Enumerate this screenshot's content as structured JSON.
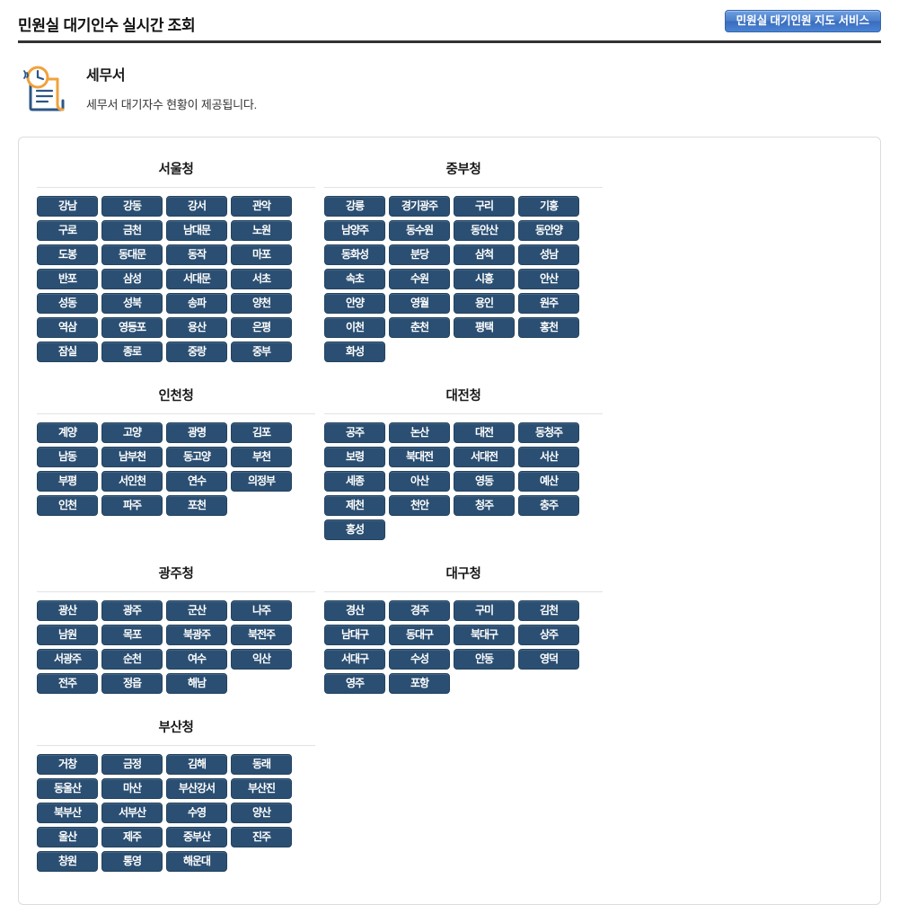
{
  "header": {
    "title": "민원실 대기인수 실시간 조회",
    "map_service_label": "민원실 대기인원 지도 서비스"
  },
  "intro": {
    "icon": "clock-document-icon",
    "heading": "세무서",
    "description": "세무서 대기자수 현황이 제공됩니다."
  },
  "colors": {
    "office_button_bg": "#2b4f72",
    "office_button_border": "#24435f",
    "map_button_bg": "#4a7fcc",
    "panel_border": "#dcdcdc",
    "header_rule": "#333333",
    "icon_navy": "#2d5686",
    "icon_orange": "#f0a23c"
  },
  "regions": [
    {
      "name": "서울청",
      "offices": [
        "강남",
        "강동",
        "강서",
        "관악",
        "구로",
        "금천",
        "남대문",
        "노원",
        "도봉",
        "동대문",
        "동작",
        "마포",
        "반포",
        "삼성",
        "서대문",
        "서초",
        "성동",
        "성북",
        "송파",
        "양천",
        "역삼",
        "영등포",
        "용산",
        "은평",
        "잠실",
        "종로",
        "중랑",
        "중부"
      ]
    },
    {
      "name": "중부청",
      "offices": [
        "강릉",
        "경기광주",
        "구리",
        "기흥",
        "남양주",
        "동수원",
        "동안산",
        "동안양",
        "동화성",
        "분당",
        "삼척",
        "성남",
        "속초",
        "수원",
        "시흥",
        "안산",
        "안양",
        "영월",
        "용인",
        "원주",
        "이천",
        "춘천",
        "평택",
        "홍천",
        "화성"
      ]
    },
    {
      "name": "인천청",
      "offices": [
        "계양",
        "고양",
        "광명",
        "김포",
        "남동",
        "남부천",
        "동고양",
        "부천",
        "부평",
        "서인천",
        "연수",
        "의정부",
        "인천",
        "파주",
        "포천"
      ]
    },
    {
      "name": "대전청",
      "offices": [
        "공주",
        "논산",
        "대전",
        "동청주",
        "보령",
        "북대전",
        "서대전",
        "서산",
        "세종",
        "아산",
        "영동",
        "예산",
        "제천",
        "천안",
        "청주",
        "충주",
        "홍성"
      ]
    },
    {
      "name": "광주청",
      "offices": [
        "광산",
        "광주",
        "군산",
        "나주",
        "남원",
        "목포",
        "북광주",
        "북전주",
        "서광주",
        "순천",
        "여수",
        "익산",
        "전주",
        "정읍",
        "해남"
      ]
    },
    {
      "name": "대구청",
      "offices": [
        "경산",
        "경주",
        "구미",
        "김천",
        "남대구",
        "동대구",
        "북대구",
        "상주",
        "서대구",
        "수성",
        "안동",
        "영덕",
        "영주",
        "포항"
      ]
    },
    {
      "name": "부산청",
      "offices": [
        "거창",
        "금정",
        "김해",
        "동래",
        "동울산",
        "마산",
        "부산강서",
        "부산진",
        "북부산",
        "서부산",
        "수영",
        "양산",
        "울산",
        "제주",
        "중부산",
        "진주",
        "창원",
        "통영",
        "해운대"
      ]
    }
  ]
}
